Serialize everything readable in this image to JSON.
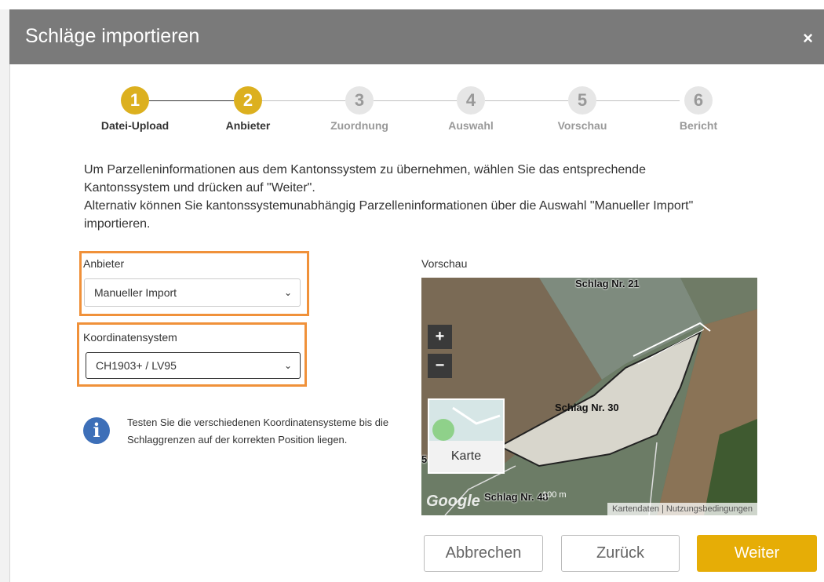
{
  "dialog": {
    "title": "Schläge importieren",
    "close_glyph": "×"
  },
  "stepper": {
    "steps": [
      {
        "number": "1",
        "label": "Datei-Upload",
        "state": "done"
      },
      {
        "number": "2",
        "label": "Anbieter",
        "state": "current"
      },
      {
        "number": "3",
        "label": "Zuordnung",
        "state": "upcoming"
      },
      {
        "number": "4",
        "label": "Auswahl",
        "state": "upcoming"
      },
      {
        "number": "5",
        "label": "Vorschau",
        "state": "upcoming"
      },
      {
        "number": "6",
        "label": "Bericht",
        "state": "upcoming"
      }
    ]
  },
  "intro": {
    "line1": "Um Parzelleninformationen aus dem Kantonssystem zu übernehmen, wählen Sie das entsprechende Kantonssystem und drücken auf \"Weiter\".",
    "line2": "Alternativ können Sie kantonssystemunabhängig Parzelleninformationen über die Auswahl \"Manueller Import\" importieren."
  },
  "form": {
    "provider_label": "Anbieter",
    "provider_value": "Manueller Import",
    "coord_label": "Koordinatensystem",
    "coord_value": "CH1903+ / LV95"
  },
  "info": {
    "icon_glyph": "i",
    "text": "Testen Sie die verschiedenen Koordinatensysteme bis die Schlaggrenzen auf der korrekten Position liegen."
  },
  "preview": {
    "label": "Vorschau",
    "zoom_in": "+",
    "zoom_out": "−",
    "map_type_button": "Karte",
    "parcel_labels": [
      "Schlag Nr. 21",
      "Schlag Nr. 30",
      "Schlag Nr. 48"
    ],
    "cut_label": "5",
    "logo_text": "Google",
    "scale_text": "100 m",
    "attribution": "Kartendaten  |  Nutzungsbedingungen"
  },
  "actions": {
    "cancel": "Abbrechen",
    "back": "Zurück",
    "next": "Weiter"
  },
  "colors": {
    "header_bg": "#7a7a7a",
    "accent": "#dcb01f",
    "primary_button": "#e6ad06",
    "highlight_box": "#f0913a",
    "info_icon": "#3d6fb8"
  }
}
